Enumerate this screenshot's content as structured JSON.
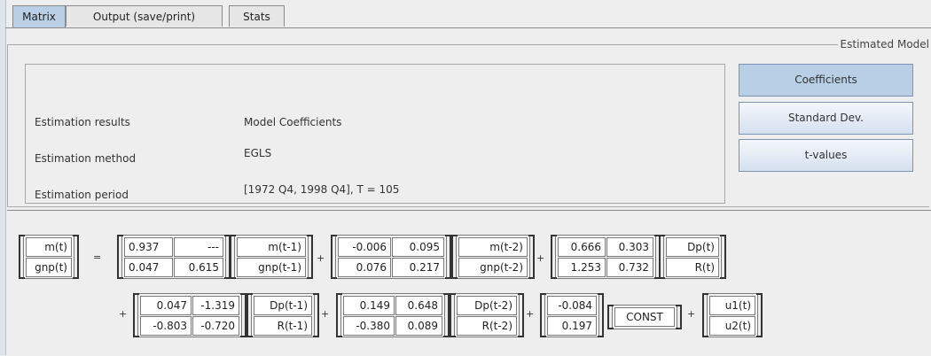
{
  "tabs": [
    "Matrix",
    "Output (save/print)",
    "Stats"
  ],
  "model_title": "Estimated Model",
  "results": {
    "rows": [
      {
        "label": "Estimation results",
        "value": "Model Coefficients"
      },
      {
        "label": "Estimation method",
        "value": "EGLS"
      },
      {
        "label": "Estimation period",
        "value": "[1972 Q4, 1998 Q4], T = 105"
      }
    ]
  },
  "buttons": {
    "coefficients": "Coefficients",
    "stddev": "Standard Dev.",
    "tvalues": "t-values"
  },
  "equation": {
    "lhs": [
      "m(t)",
      "gnp(t)"
    ],
    "equals": "=",
    "plus": "+",
    "A1": [
      [
        "0.937",
        "---"
      ],
      [
        "0.047",
        "0.615"
      ]
    ],
    "y1": [
      "m(t-1)",
      "gnp(t-1)"
    ],
    "A2": [
      [
        "-0.006",
        "0.095"
      ],
      [
        "0.076",
        "0.217"
      ]
    ],
    "y2": [
      "m(t-2)",
      "gnp(t-2)"
    ],
    "B0": [
      [
        "0.666",
        "0.303"
      ],
      [
        "1.253",
        "0.732"
      ]
    ],
    "x0": [
      "Dp(t)",
      "R(t)"
    ],
    "B1": [
      [
        "0.047",
        "-1.319"
      ],
      [
        "-0.803",
        "-0.720"
      ]
    ],
    "x1": [
      "Dp(t-1)",
      "R(t-1)"
    ],
    "B2": [
      [
        "0.149",
        "0.648"
      ],
      [
        "-0.380",
        "0.089"
      ]
    ],
    "x2": [
      "Dp(t-2)",
      "R(t-2)"
    ],
    "C": [
      "-0.084",
      "0.197"
    ],
    "const": "CONST",
    "u": [
      "u1(t)",
      "u2(t)"
    ]
  }
}
